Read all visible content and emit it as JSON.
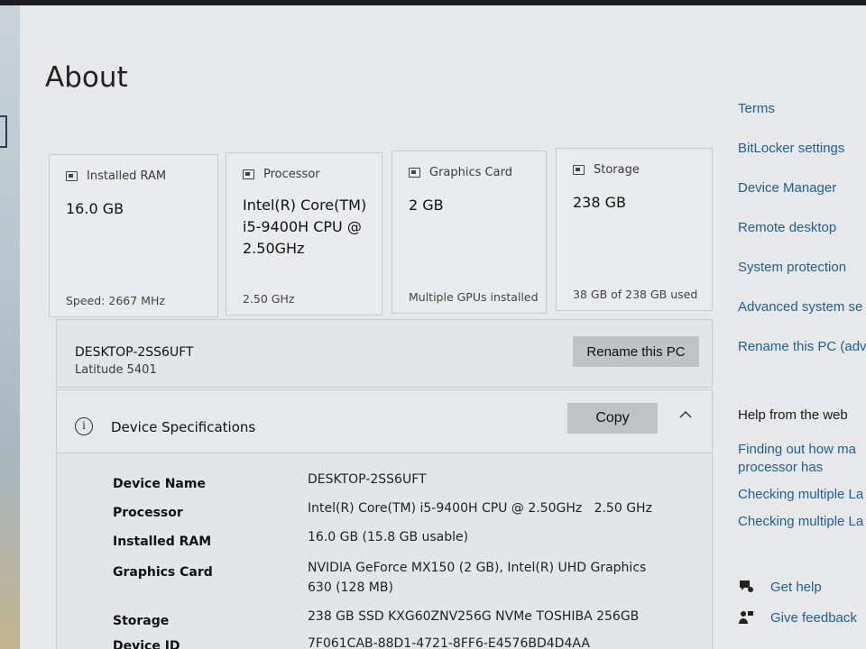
{
  "page": {
    "title": "About"
  },
  "cards": [
    {
      "icon": "memory-icon",
      "label": "Installed RAM",
      "value": "16.0 GB",
      "foot": "Speed: 2667 MHz"
    },
    {
      "icon": "processor-icon",
      "label": "Processor",
      "value": "Intel(R) Core(TM) i5-9400H CPU @ 2.50GHz",
      "foot": "2.50 GHz"
    },
    {
      "icon": "graphics-card-icon",
      "label": "Graphics Card",
      "value": "2 GB",
      "foot": "Multiple GPUs installed"
    },
    {
      "icon": "storage-icon",
      "label": "Storage",
      "value": "238 GB",
      "foot": "38 GB of 238 GB used"
    }
  ],
  "pc": {
    "name": "DESKTOP-2SS6UFT",
    "model": "Latitude 5401",
    "rename_label": "Rename this PC"
  },
  "specs": {
    "title": "Device Specifications",
    "copy_label": "Copy",
    "rows": [
      {
        "label": "Device Name",
        "value": "DESKTOP-2SS6UFT"
      },
      {
        "label": "Processor",
        "value": "Intel(R) Core(TM) i5-9400H CPU @ 2.50GHz   2.50 GHz"
      },
      {
        "label": "Installed RAM",
        "value": "16.0 GB (15.8 GB usable)"
      },
      {
        "label": "Graphics Card",
        "value": "NVIDIA GeForce MX150 (2 GB), Intel(R) UHD Graphics 630 (128 MB)"
      },
      {
        "label": "Storage",
        "value": "238 GB SSD KXG60ZNV256G NVMe TOSHIBA 256GB"
      },
      {
        "label": "Device ID",
        "value": "7F061CAB-88D1-4721-8FF6-E4576BD4D4AA"
      }
    ]
  },
  "related": {
    "links": [
      "Terms",
      "BitLocker settings",
      "Device Manager",
      "Remote desktop",
      "System protection",
      "Advanced system se",
      "Rename this PC (adv"
    ]
  },
  "help": {
    "heading": "Help from the web",
    "links": [
      "Finding out how ma",
      "processor has",
      "Checking multiple La",
      "Checking multiple La"
    ],
    "get_help": "Get help",
    "give_feedback": "Give feedback"
  }
}
